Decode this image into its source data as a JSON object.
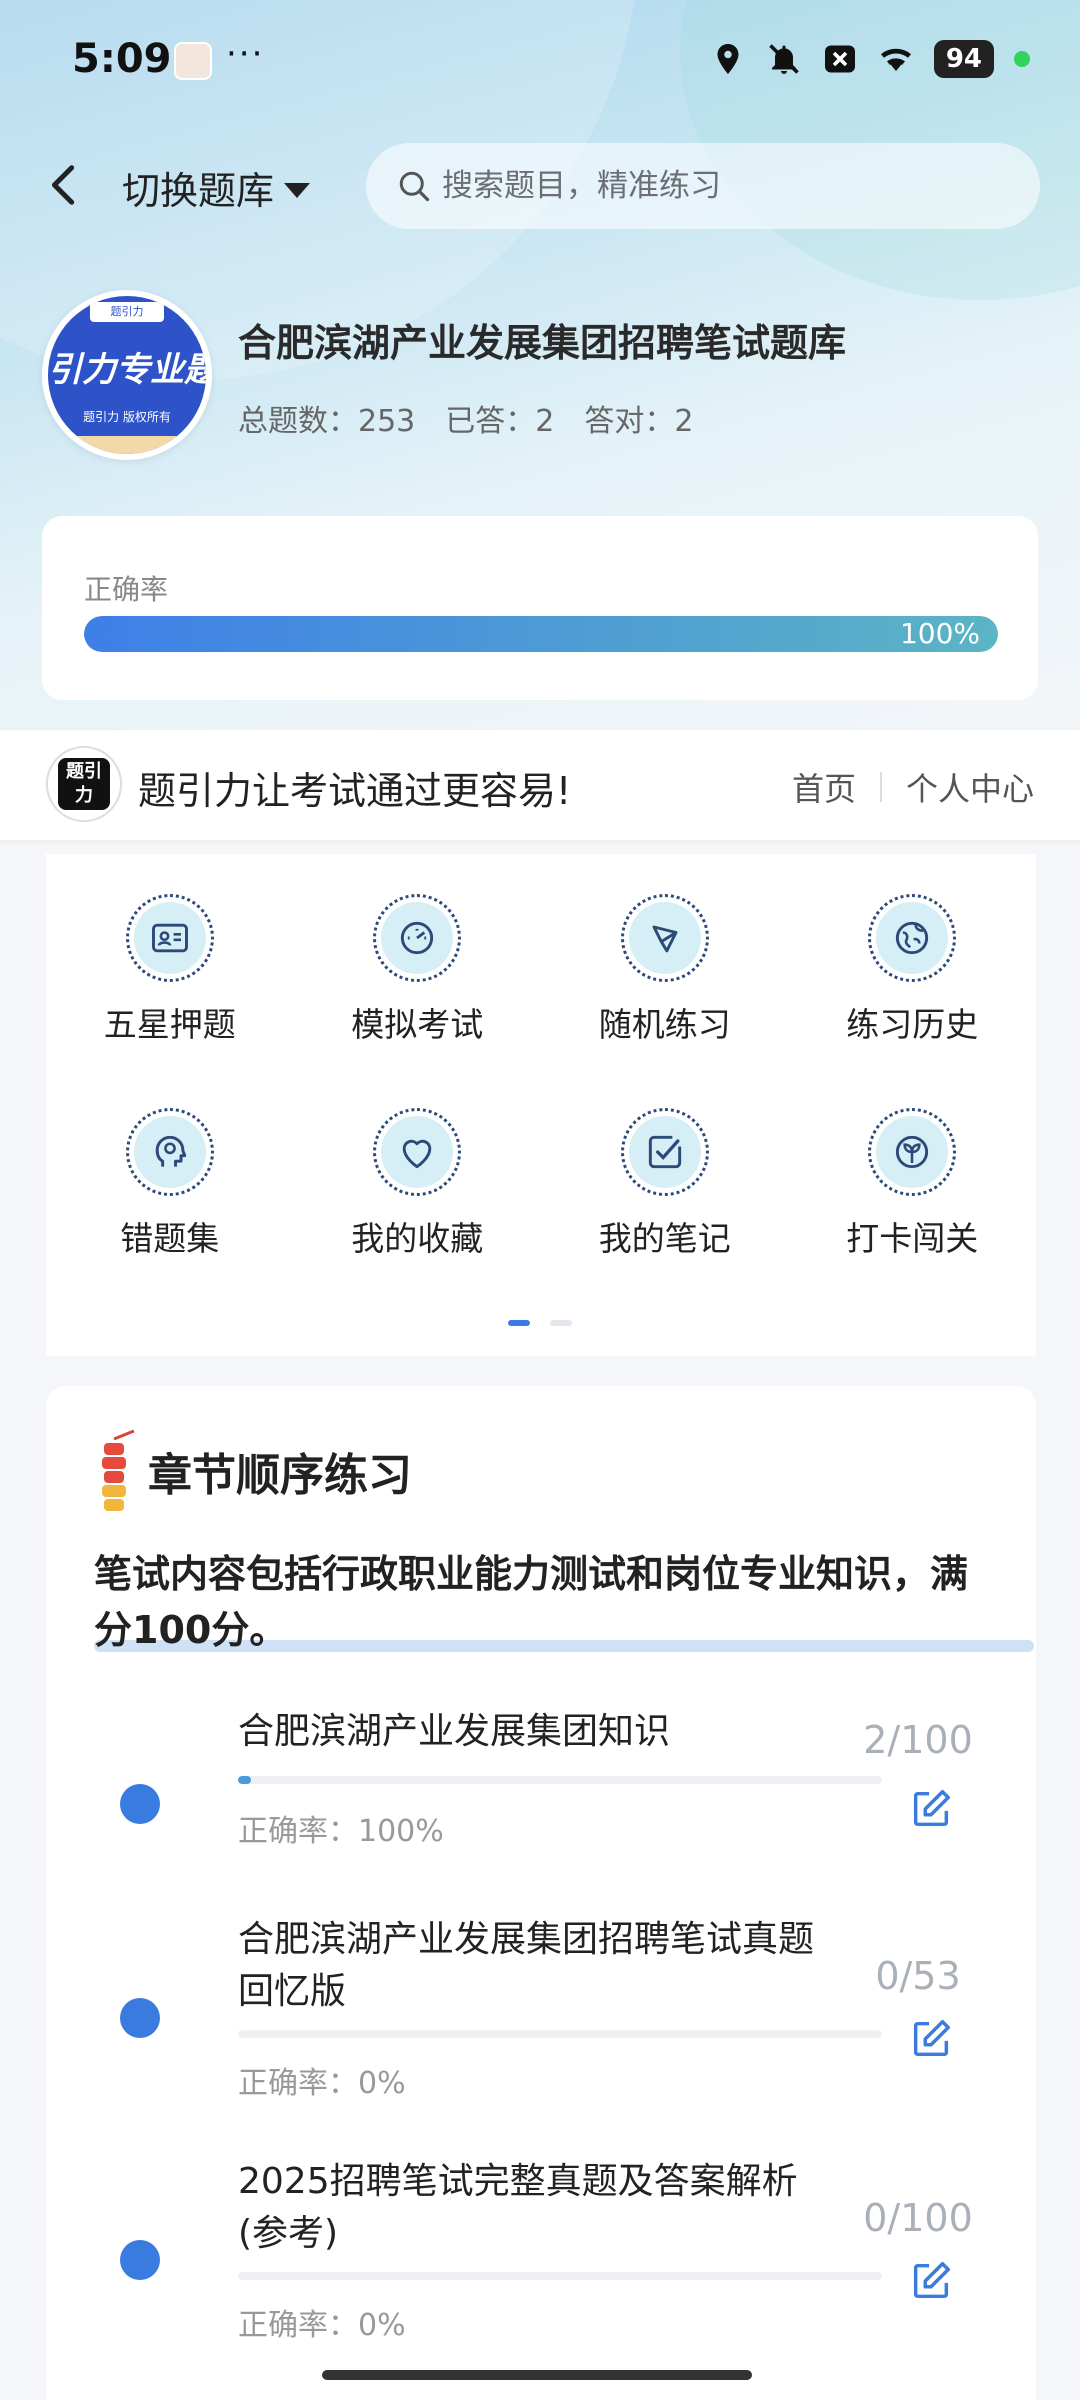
{
  "status_bar": {
    "time": "5:09",
    "dots": "···",
    "battery": "94"
  },
  "header": {
    "switch_label": "切换题库",
    "search_placeholder": "搜索题目，精准练习"
  },
  "bank": {
    "logo_tag": "题引力",
    "logo_text": "引力专业题",
    "logo_sub": "题引力 版权所有",
    "title": "合肥滨湖产业发展集团招聘笔试题库",
    "total": "总题数：253",
    "answered": "已答：2",
    "correct": "答对：2"
  },
  "accuracy": {
    "label": "正确率",
    "value_text": "100%",
    "fraction": 1.0
  },
  "brand": {
    "logo_mark": "题引力",
    "slogan": "题引力让考试通过更容易!",
    "nav": [
      "首页",
      "个人中心"
    ]
  },
  "features": [
    {
      "label": "五星押题",
      "icon": "id-card-icon"
    },
    {
      "label": "模拟考试",
      "icon": "gauge-icon"
    },
    {
      "label": "随机练习",
      "icon": "shuffle-icon"
    },
    {
      "label": "练习历史",
      "icon": "globe-icon"
    },
    {
      "label": "错题集",
      "icon": "head-icon"
    },
    {
      "label": "我的收藏",
      "icon": "heart-icon"
    },
    {
      "label": "我的笔记",
      "icon": "note-icon"
    },
    {
      "label": "打卡闯关",
      "icon": "leaf-icon"
    }
  ],
  "pager": {
    "pages": 2,
    "active": 0
  },
  "chapters": {
    "title": "章节顺序练习",
    "description": "笔试内容包括行政职业能力测试和岗位专业知识，满分100分。",
    "items": [
      {
        "name": "合肥滨湖产业发展集团知识",
        "accuracy": "正确率：100%",
        "count": "2/100",
        "progress": 0.02
      },
      {
        "name": "合肥滨湖产业发展集团招聘笔试真题回忆版",
        "accuracy": "正确率：0%",
        "count": "0/53",
        "progress": 0
      },
      {
        "name": "2025招聘笔试完整真题及答案解析(参考)",
        "accuracy": "正确率：0%",
        "count": "0/100",
        "progress": 0
      }
    ]
  },
  "colors": {
    "accent": "#3a7be0",
    "icon_bg": "#d6eef6",
    "icon_stroke": "#2c4a78"
  }
}
